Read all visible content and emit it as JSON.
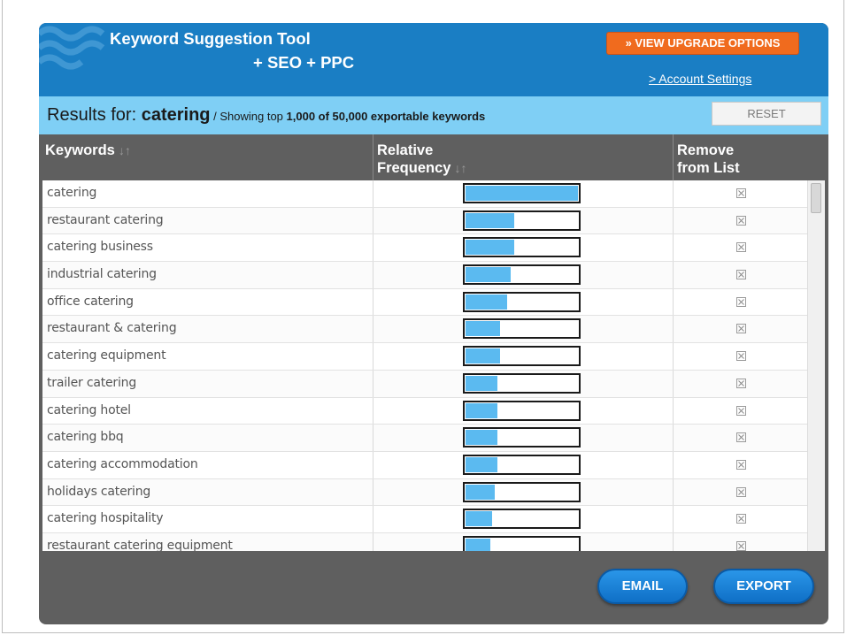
{
  "header": {
    "title_line1": "Keyword Suggestion Tool",
    "title_line2": "+ SEO + PPC",
    "upgrade_button": "» VIEW UPGRADE OPTIONS",
    "account_link": "> Account Settings",
    "colors": {
      "header_bg": "#1a7ec4",
      "upgrade_bg": "#f06b1e"
    }
  },
  "results": {
    "label": "Results for: ",
    "term": "catering",
    "showing_prefix": " / Showing top ",
    "showing_count": "1,000 of 50,000 exportable keywords",
    "reset_button": "RESET"
  },
  "table": {
    "columns": {
      "keywords": "Keywords",
      "frequency_line1": "Relative",
      "frequency_line2": "Frequency",
      "remove_line1": "Remove",
      "remove_line2": "from List",
      "sort_icon": "↓↑"
    },
    "rows": [
      {
        "keyword": "catering",
        "frequency": 1.0
      },
      {
        "keyword": "restaurant catering",
        "frequency": 0.43
      },
      {
        "keyword": "catering business",
        "frequency": 0.43
      },
      {
        "keyword": "industrial catering",
        "frequency": 0.4
      },
      {
        "keyword": "office catering",
        "frequency": 0.37
      },
      {
        "keyword": "restaurant & catering",
        "frequency": 0.31
      },
      {
        "keyword": "catering equipment",
        "frequency": 0.31
      },
      {
        "keyword": "trailer catering",
        "frequency": 0.28
      },
      {
        "keyword": "catering hotel",
        "frequency": 0.28
      },
      {
        "keyword": "catering bbq",
        "frequency": 0.28
      },
      {
        "keyword": "catering accommodation",
        "frequency": 0.28
      },
      {
        "keyword": "holidays catering",
        "frequency": 0.26
      },
      {
        "keyword": "catering hospitality",
        "frequency": 0.24
      },
      {
        "keyword": "restaurant catering equipment",
        "frequency": 0.22
      }
    ]
  },
  "footer": {
    "email_button": "EMAIL",
    "export_button": "EXPORT"
  }
}
